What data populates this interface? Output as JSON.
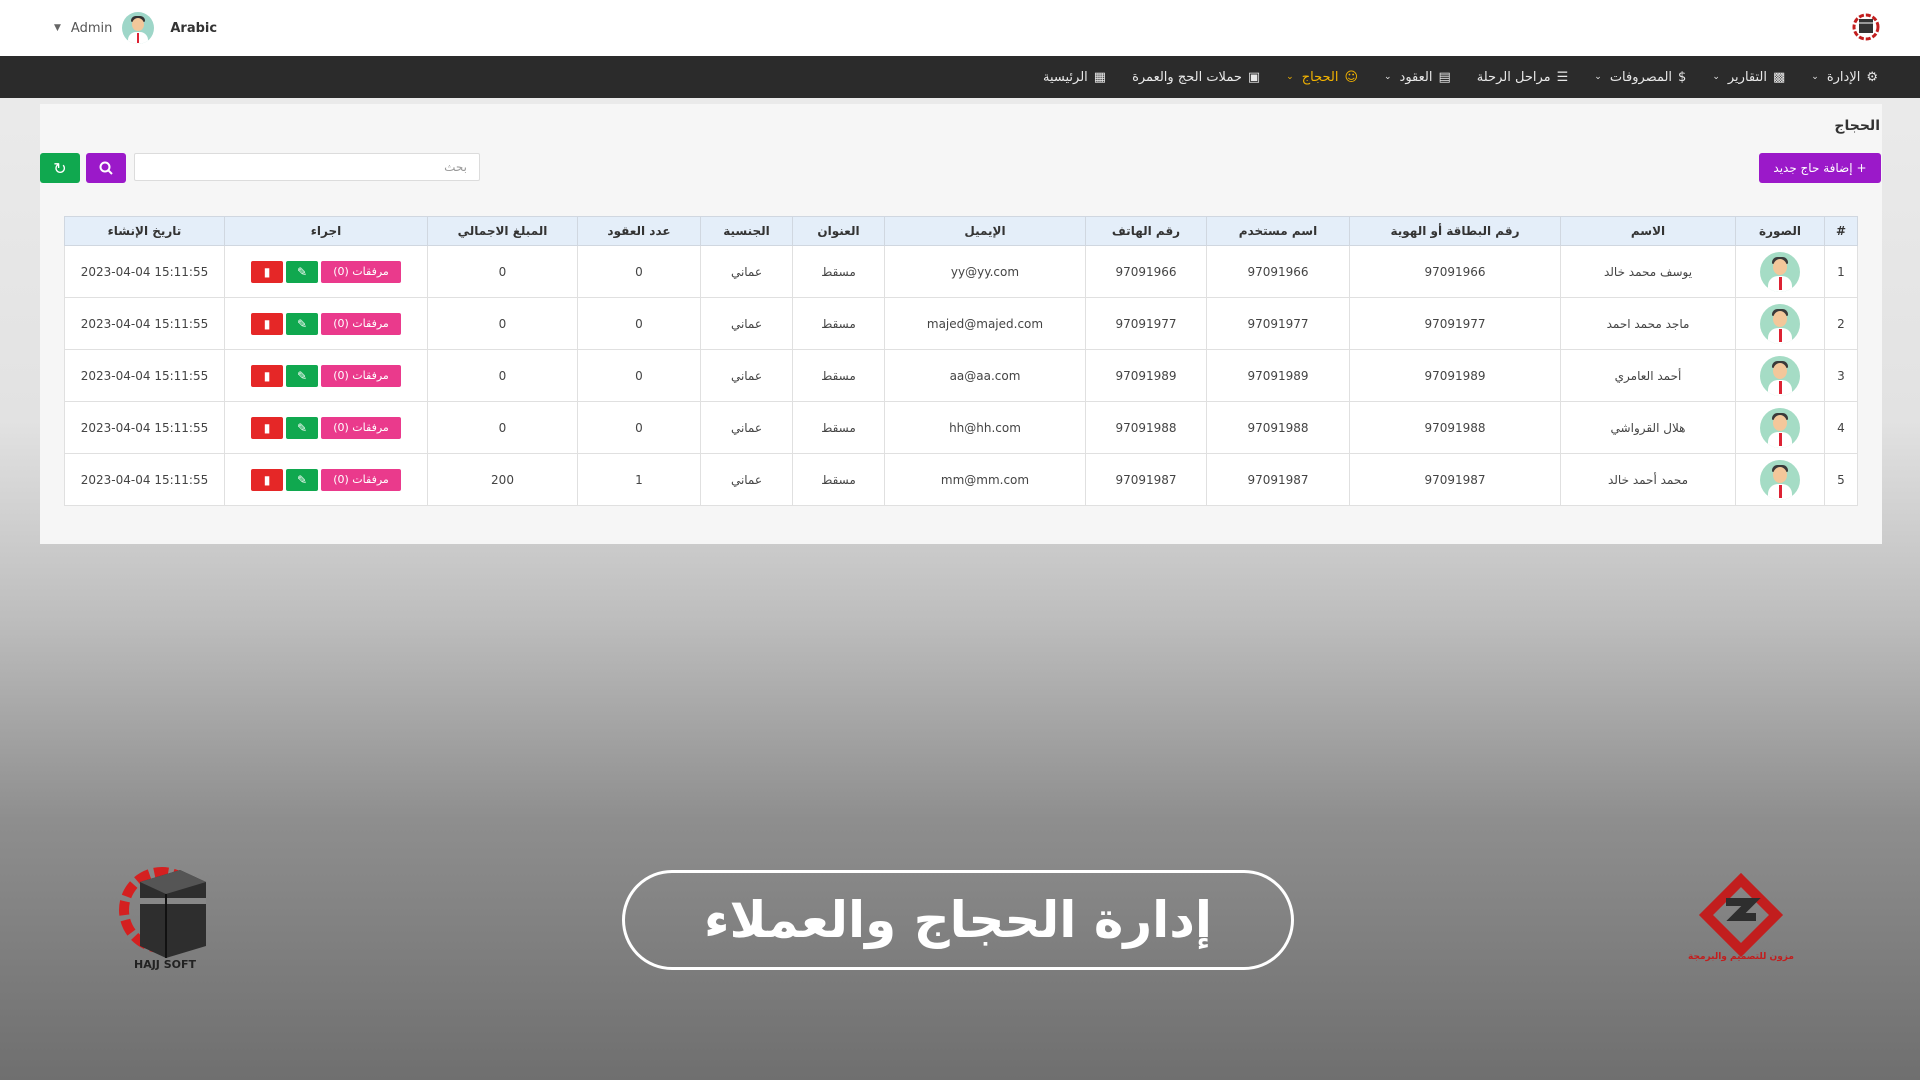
{
  "topbar": {
    "user_name": "Admin",
    "language": "Arabic"
  },
  "nav": {
    "items": [
      {
        "label": "الرئيسية",
        "icon": "dashboard-icon",
        "dropdown": false,
        "active": false
      },
      {
        "label": "حملات الحج والعمرة",
        "icon": "kaaba-icon",
        "dropdown": false,
        "active": false
      },
      {
        "label": "الحجاج",
        "icon": "users-icon",
        "dropdown": true,
        "active": true
      },
      {
        "label": "العقود",
        "icon": "document-icon",
        "dropdown": true,
        "active": false
      },
      {
        "label": "مراحل الرحلة",
        "icon": "list-icon",
        "dropdown": false,
        "active": false
      },
      {
        "label": "المصروفات",
        "icon": "dollar-icon",
        "dropdown": true,
        "active": false
      },
      {
        "label": "التقارير",
        "icon": "chart-icon",
        "dropdown": true,
        "active": false
      },
      {
        "label": "الإدارة",
        "icon": "gear-icon",
        "dropdown": true,
        "active": false
      }
    ]
  },
  "page": {
    "title": "الحجاج",
    "add_label": "إضافة حاج جديد",
    "add_plus": "+"
  },
  "search": {
    "placeholder": "بحث"
  },
  "table": {
    "headers": [
      "#",
      "الصورة",
      "الاسم",
      "رقم البطاقة أو الهوية",
      "اسم مستخدم",
      "رقم الهاتف",
      "الإيميل",
      "العنوان",
      "الجنسية",
      "عدد العقود",
      "المبلغ الاجمالي",
      "اجراء",
      "تاريخ الإنشاء"
    ],
    "attachments_label": "مرفقات (0)",
    "rows": [
      {
        "num": "1",
        "name": "يوسف محمد خالد",
        "id_card": "97091966",
        "username": "97091966",
        "phone": "97091966",
        "email": "yy@yy.com",
        "address": "مسقط",
        "nationality": "عماني",
        "contracts": "0",
        "total": "0",
        "created": "15:11:55 2023-04-04"
      },
      {
        "num": "2",
        "name": "ماجد محمد احمد",
        "id_card": "97091977",
        "username": "97091977",
        "phone": "97091977",
        "email": "majed@majed.com",
        "address": "مسقط",
        "nationality": "عماني",
        "contracts": "0",
        "total": "0",
        "created": "15:11:55 2023-04-04"
      },
      {
        "num": "3",
        "name": "أحمد العامري",
        "id_card": "97091989",
        "username": "97091989",
        "phone": "97091989",
        "email": "aa@aa.com",
        "address": "مسقط",
        "nationality": "عماني",
        "contracts": "0",
        "total": "0",
        "created": "15:11:55 2023-04-04"
      },
      {
        "num": "4",
        "name": "هلال القرواشي",
        "id_card": "97091988",
        "username": "97091988",
        "phone": "97091988",
        "email": "hh@hh.com",
        "address": "مسقط",
        "nationality": "عماني",
        "contracts": "0",
        "total": "0",
        "created": "15:11:55 2023-04-04"
      },
      {
        "num": "5",
        "name": "محمد أحمد خالد",
        "id_card": "97091987",
        "username": "97091987",
        "phone": "97091987",
        "email": "mm@mm.com",
        "address": "مسقط",
        "nationality": "عماني",
        "contracts": "1",
        "total": "200",
        "created": "15:11:55 2023-04-04"
      }
    ]
  },
  "overlay": {
    "banner_text": "إدارة الحجاج والعملاء",
    "left_logo_text": "HAJJ SOFT",
    "right_logo_text": "مزون للتصميم والبرمجة"
  },
  "colors": {
    "accent": "#9b19c9",
    "success": "#10a84f",
    "danger": "#e52727",
    "attachments": "#ea3a8c",
    "nav_active": "#f4b400"
  }
}
